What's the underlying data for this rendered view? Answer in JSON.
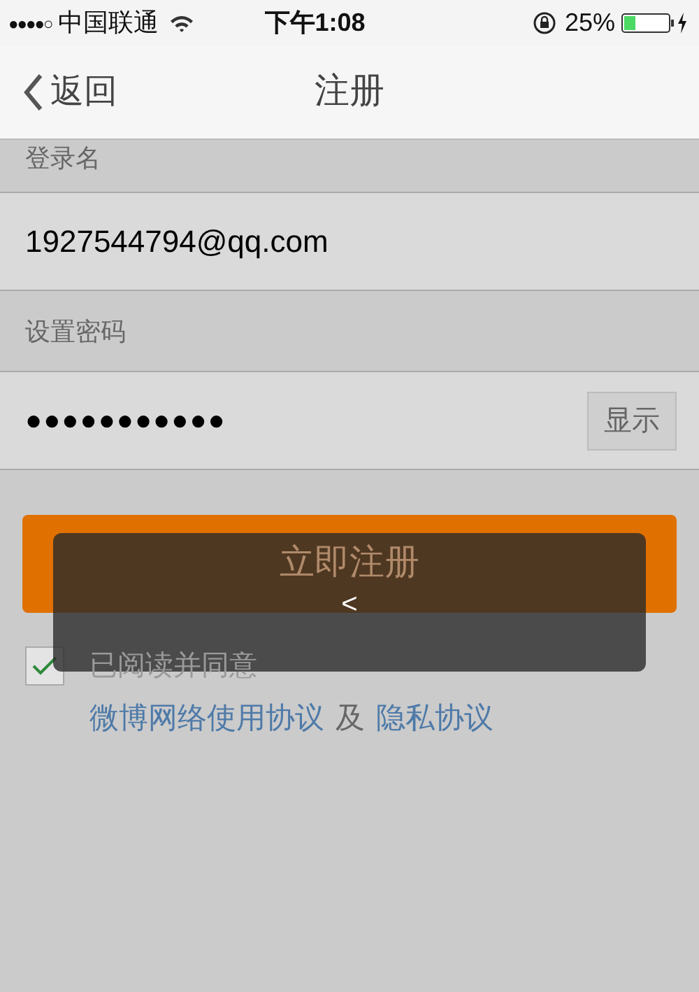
{
  "status_bar": {
    "signal": "●●●●○",
    "carrier": "中国联通",
    "time": "下午1:08",
    "battery_percent": "25%"
  },
  "nav": {
    "back": "返回",
    "title": "注册"
  },
  "fields": [
    {
      "kind": "text",
      "label": "登录名",
      "value": "1927544794@qq.com"
    },
    {
      "kind": "password",
      "label": "设置密码",
      "value": "●●●●●●●●●●●",
      "toggle": "显示"
    }
  ],
  "submit": "立即注册",
  "agreement": {
    "checked": true,
    "text": "已阅读并同意",
    "links": [
      "微博网络使用协议",
      "隐私协议"
    ],
    "conjunction": "及"
  },
  "toast": {
    "text": "<"
  }
}
